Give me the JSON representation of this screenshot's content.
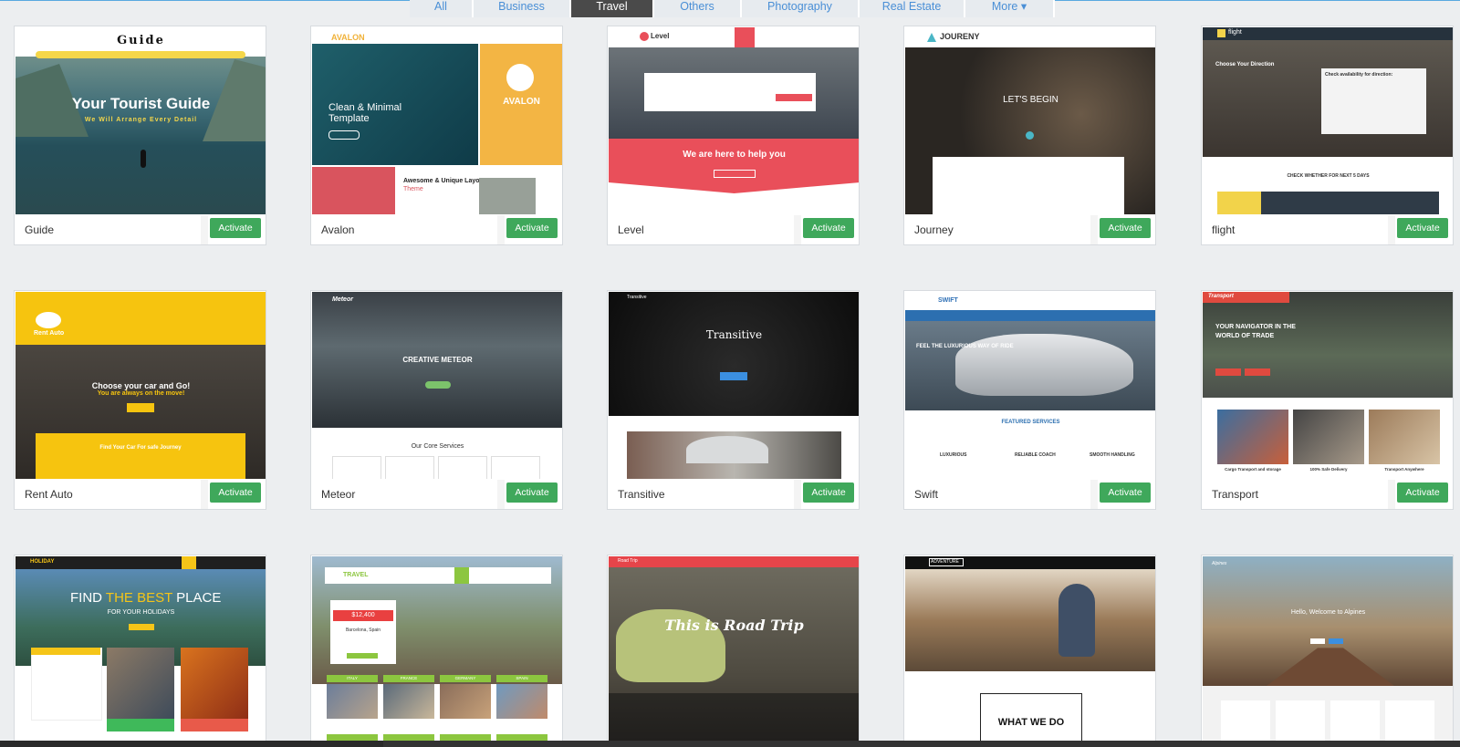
{
  "tabs": [
    "All",
    "Business",
    "Travel",
    "Others",
    "Photography",
    "Real Estate",
    "More ▾"
  ],
  "active_tab": "Travel",
  "activate_label": "Activate",
  "templates": [
    {
      "name": "Guide",
      "thumb": {
        "logo": "Guide",
        "title": "Your Tourist Guide",
        "subtitle": "We Will Arrange Every Detail"
      }
    },
    {
      "name": "Avalon",
      "thumb": {
        "logo": "AVALON",
        "title": "Clean & Minimal Template",
        "badge": "AVALON",
        "section": "Awesome & Unique Layout",
        "section2": "Theme"
      }
    },
    {
      "name": "Level",
      "thumb": {
        "logo": "Level",
        "title": "We are here to help you"
      }
    },
    {
      "name": "Journey",
      "thumb": {
        "logo": "JOURENY",
        "title": "LET'S BEGIN"
      }
    },
    {
      "name": "flight",
      "thumb": {
        "logo": "flight",
        "title": "Choose Your Direction",
        "panel": "Check availability for direction:",
        "cta": "CHECK WHETHER FOR NEXT 5 DAYS"
      }
    },
    {
      "name": "Rent Auto",
      "thumb": {
        "logo": "Rent Auto",
        "title": "Choose your car and Go!",
        "subtitle": "You are always on the move!",
        "panel": "Find Your Car For safe Journey"
      }
    },
    {
      "name": "Meteor",
      "thumb": {
        "logo": "Meteor",
        "title": "CREATIVE METEOR",
        "section": "Our Core Services"
      }
    },
    {
      "name": "Transitive",
      "thumb": {
        "logo": "Transitive",
        "title": "Transitive"
      }
    },
    {
      "name": "Swift",
      "thumb": {
        "logo": "SWIFT",
        "title": "FEEL THE LUXURIOUS WAY OF RIDE",
        "section": "FEATURED SERVICES",
        "features": [
          "LUXURIOUS",
          "RELIABLE COACH",
          "SMOOTH HANDLING"
        ]
      }
    },
    {
      "name": "Transport",
      "thumb": {
        "logo": "Transport",
        "title": "YOUR NAVIGATOR IN THE WORLD OF TRADE",
        "captions": [
          "Cargo Transport and storage",
          "100% Safe Delivery",
          "Transport Anywhere"
        ]
      }
    },
    {
      "name": "",
      "thumb": {
        "logo": "HOLIDAY",
        "title_a": "FIND",
        "title_b": "THE BEST",
        "title_c": "PLACE",
        "subtitle": "FOR YOUR HOLIDAYS"
      }
    },
    {
      "name": "",
      "thumb": {
        "logo": "TRAVEL",
        "price": "$12,400",
        "place": "Barcelona, Spain",
        "labels": [
          "ITALY",
          "FRANCE",
          "GERMANY",
          "SPAIN"
        ]
      }
    },
    {
      "name": "",
      "thumb": {
        "logo": "Road Trip",
        "title": "This is Road Trip"
      }
    },
    {
      "name": "",
      "thumb": {
        "logo": "ADVENTURE",
        "title": "WHAT WE DO"
      }
    },
    {
      "name": "",
      "thumb": {
        "logo": "Alpines",
        "title": "Hello, Welcome to Alpines"
      }
    }
  ],
  "colors": {
    "accent_blue": "#4a8fd6",
    "activate_green": "#3fa85b",
    "active_tab": "#4a4a4a"
  }
}
